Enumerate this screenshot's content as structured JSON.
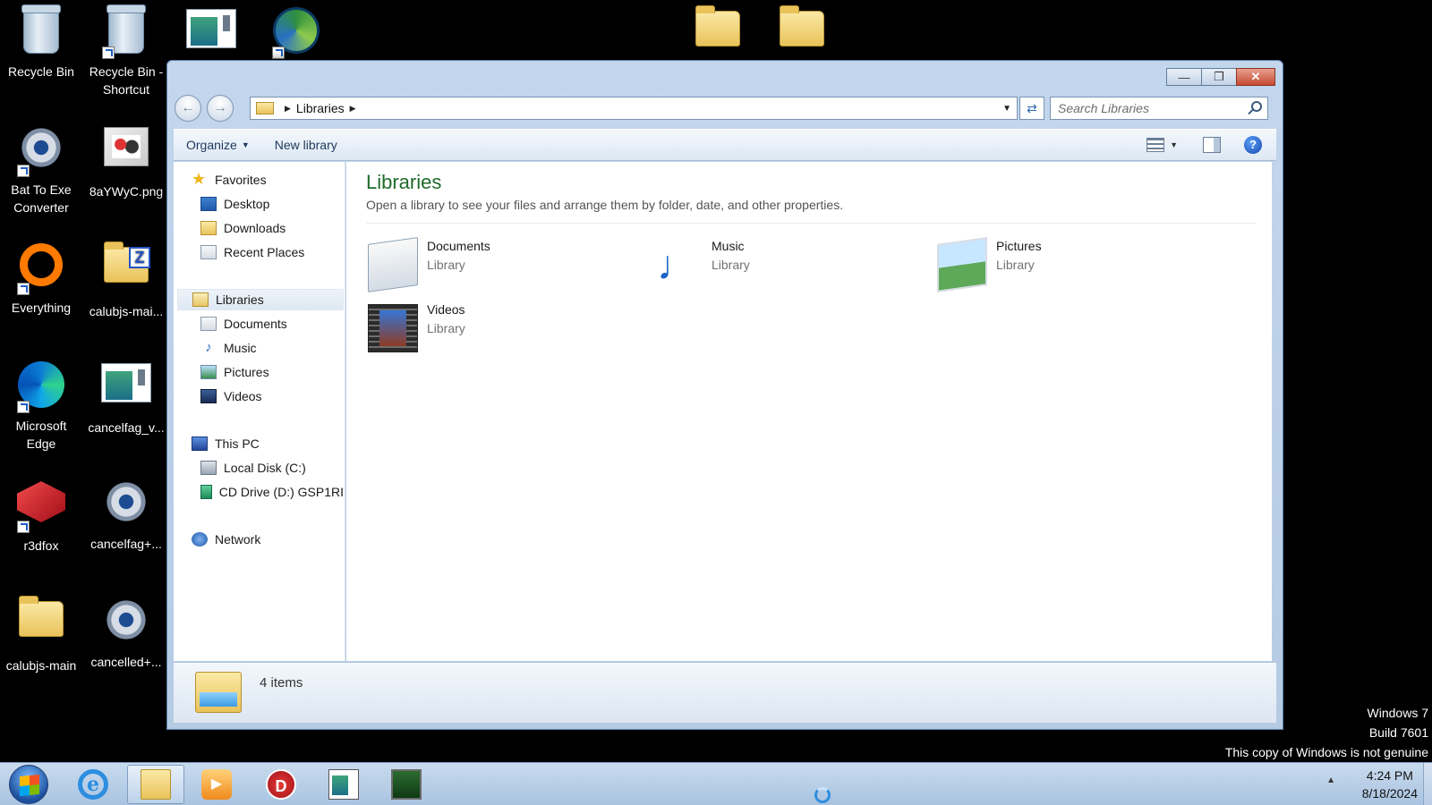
{
  "desktop": {
    "icons": [
      {
        "label": "Recycle Bin"
      },
      {
        "label": "Recycle Bin - Shortcut"
      },
      {
        "label": "Bat To Exe Converter"
      },
      {
        "label": "8aYWyC.png"
      },
      {
        "label": "Everything"
      },
      {
        "label": "calubjs-mai..."
      },
      {
        "label": "Microsoft Edge"
      },
      {
        "label": "cancelfag_v..."
      },
      {
        "label": "r3dfox"
      },
      {
        "label": "cancelfag+..."
      },
      {
        "label": "calubjs-main"
      },
      {
        "label": "cancelled+..."
      }
    ],
    "watermark": {
      "line1": "Windows 7",
      "line2": "Build 7601",
      "line3": "This copy of Windows is not genuine"
    }
  },
  "explorer": {
    "address": {
      "crumb": "Libraries"
    },
    "search": {
      "placeholder": "Search Libraries"
    },
    "toolbar": {
      "organize": "Organize",
      "new_library": "New library"
    },
    "nav": {
      "favorites": "Favorites",
      "desktop": "Desktop",
      "downloads": "Downloads",
      "recent_places": "Recent Places",
      "libraries": "Libraries",
      "documents": "Documents",
      "music": "Music",
      "pictures": "Pictures",
      "videos": "Videos",
      "this_pc": "This PC",
      "local_disk": "Local Disk (C:)",
      "cd_drive": "CD Drive (D:) GSP1RI",
      "network": "Network"
    },
    "content": {
      "title": "Libraries",
      "subtitle": "Open a library to see your files and arrange them by folder, date, and other properties.",
      "items": [
        {
          "name": "Documents",
          "type": "Library",
          "icon": "documents-library-icon"
        },
        {
          "name": "Music",
          "type": "Library",
          "icon": "music-library-icon"
        },
        {
          "name": "Pictures",
          "type": "Library",
          "icon": "pictures-library-icon"
        },
        {
          "name": "Videos",
          "type": "Library",
          "icon": "videos-library-icon"
        }
      ]
    },
    "status": {
      "count": "4 items"
    }
  },
  "taskbar": {
    "time": "4:24 PM",
    "date": "8/18/2024"
  }
}
